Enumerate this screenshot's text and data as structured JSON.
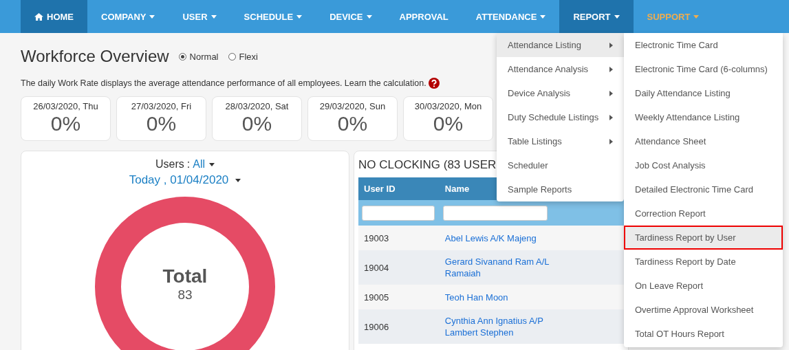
{
  "nav": [
    {
      "label": "HOME",
      "kind": "home",
      "selected": true
    },
    {
      "label": "COMPANY",
      "kind": "dropdown",
      "selected": false
    },
    {
      "label": "USER",
      "kind": "dropdown",
      "selected": false
    },
    {
      "label": "SCHEDULE",
      "kind": "dropdown",
      "selected": false
    },
    {
      "label": "DEVICE",
      "kind": "dropdown",
      "selected": false
    },
    {
      "label": "APPROVAL",
      "kind": "link",
      "selected": false
    },
    {
      "label": "ATTENDANCE",
      "kind": "dropdown",
      "selected": false
    },
    {
      "label": "REPORT",
      "kind": "dropdown",
      "selected": true
    },
    {
      "label": "SUPPORT",
      "kind": "dropdown",
      "selected": false,
      "color": "#f0ad4e"
    }
  ],
  "title": "Workforce Overview",
  "modes": [
    {
      "label": "Normal",
      "selected": true
    },
    {
      "label": "Flexi",
      "selected": false
    }
  ],
  "description": "The daily Work Rate displays the average attendance performance of all employees. Learn the calculation.",
  "day_cards": [
    {
      "date": "26/03/2020, Thu",
      "rate": "0%"
    },
    {
      "date": "27/03/2020, Fri",
      "rate": "0%"
    },
    {
      "date": "28/03/2020, Sat",
      "rate": "0%"
    },
    {
      "date": "29/03/2020, Sun",
      "rate": "0%"
    },
    {
      "date": "30/03/2020, Mon",
      "rate": "0%"
    }
  ],
  "summary": {
    "users_label": "Users",
    "users_sep": ":",
    "users_value": "All",
    "date_value": "Today , 01/04/2020",
    "total_label": "Total",
    "total_value": "83"
  },
  "no_clocking": {
    "title": "NO CLOCKING (83 USER",
    "columns": [
      "User ID",
      "Name"
    ],
    "rows": [
      {
        "user_id": "19003",
        "name": "Abel Lewis A/K Majeng"
      },
      {
        "user_id": "19004",
        "name": "Gerard Sivanand Ram A/L Ramaiah"
      },
      {
        "user_id": "19005",
        "name": "Teoh Han Moon"
      },
      {
        "user_id": "19006",
        "name": "Cynthia Ann Ignatius A/P Lambert Stephen"
      }
    ]
  },
  "report_menu": [
    {
      "label": "Attendance Listing",
      "submenu": true,
      "selected": true
    },
    {
      "label": "Attendance Analysis",
      "submenu": true,
      "selected": false
    },
    {
      "label": "Device Analysis",
      "submenu": true,
      "selected": false
    },
    {
      "label": "Duty Schedule Listings",
      "submenu": true,
      "selected": false
    },
    {
      "label": "Table Listings",
      "submenu": true,
      "selected": false
    },
    {
      "label": "Scheduler",
      "submenu": false,
      "selected": false
    },
    {
      "label": "Sample Reports",
      "submenu": false,
      "selected": false
    }
  ],
  "attendance_listing_menu": [
    {
      "label": "Electronic Time Card",
      "selected": false
    },
    {
      "label": "Electronic Time Card (6-columns)",
      "selected": false
    },
    {
      "label": "Daily Attendance Listing",
      "selected": false
    },
    {
      "label": "Weekly Attendance Listing",
      "selected": false
    },
    {
      "label": "Attendance Sheet",
      "selected": false
    },
    {
      "label": "Job Cost Analysis",
      "selected": false
    },
    {
      "label": "Detailed Electronic Time Card",
      "selected": false
    },
    {
      "label": "Correction Report",
      "selected": false
    },
    {
      "label": "Tardiness Report by User",
      "selected": true
    },
    {
      "label": "Tardiness Report by Date",
      "selected": false
    },
    {
      "label": "On Leave Report",
      "selected": false
    },
    {
      "label": "Overtime Approval Worksheet",
      "selected": false
    },
    {
      "label": "Total OT Hours Report",
      "selected": false
    }
  ]
}
